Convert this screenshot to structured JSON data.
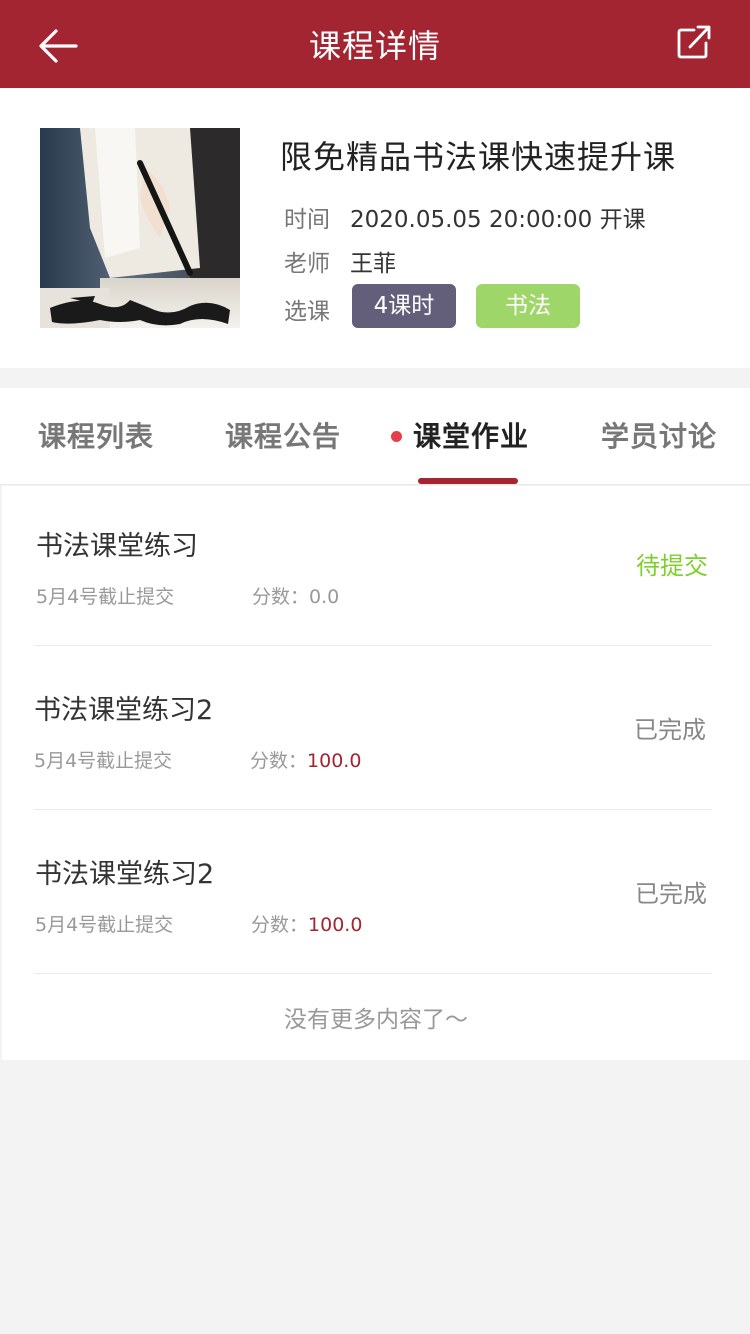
{
  "header": {
    "title": "课程详情",
    "back_icon": "arrow-left-icon",
    "share_icon": "share-icon"
  },
  "course": {
    "name": "限免精品书法课快速提升课",
    "time_label": "时间",
    "time_value": "2020.05.05 20:00:00 开课",
    "teacher_label": "老师",
    "teacher_value": "王菲",
    "select_label": "选课",
    "tags": [
      "4课时",
      "书法"
    ]
  },
  "tabs": [
    {
      "label": "课程列表",
      "active": false
    },
    {
      "label": "课程公告",
      "active": false
    },
    {
      "label": "课堂作业",
      "active": true
    },
    {
      "label": "学员讨论",
      "active": false
    }
  ],
  "assignments": [
    {
      "title": "书法课堂练习",
      "deadline": "5月4号截止提交",
      "score_label": "分数：",
      "score": "0.0",
      "status": "待提交"
    },
    {
      "title": "书法课堂练习2",
      "deadline": "5月4号截止提交",
      "score_label": "分数：",
      "score": "100.0",
      "status": "已完成"
    },
    {
      "title": "书法课堂练习2",
      "deadline": "5月4号截止提交",
      "score_label": "分数：",
      "score": "100.0",
      "status": "已完成"
    }
  ],
  "no_more": "没有更多内容了～",
  "colors": {
    "brand": "#a42532",
    "pending": "#7fcf2b",
    "tag_hours": "#635e7a",
    "tag_category": "#9fd669"
  }
}
